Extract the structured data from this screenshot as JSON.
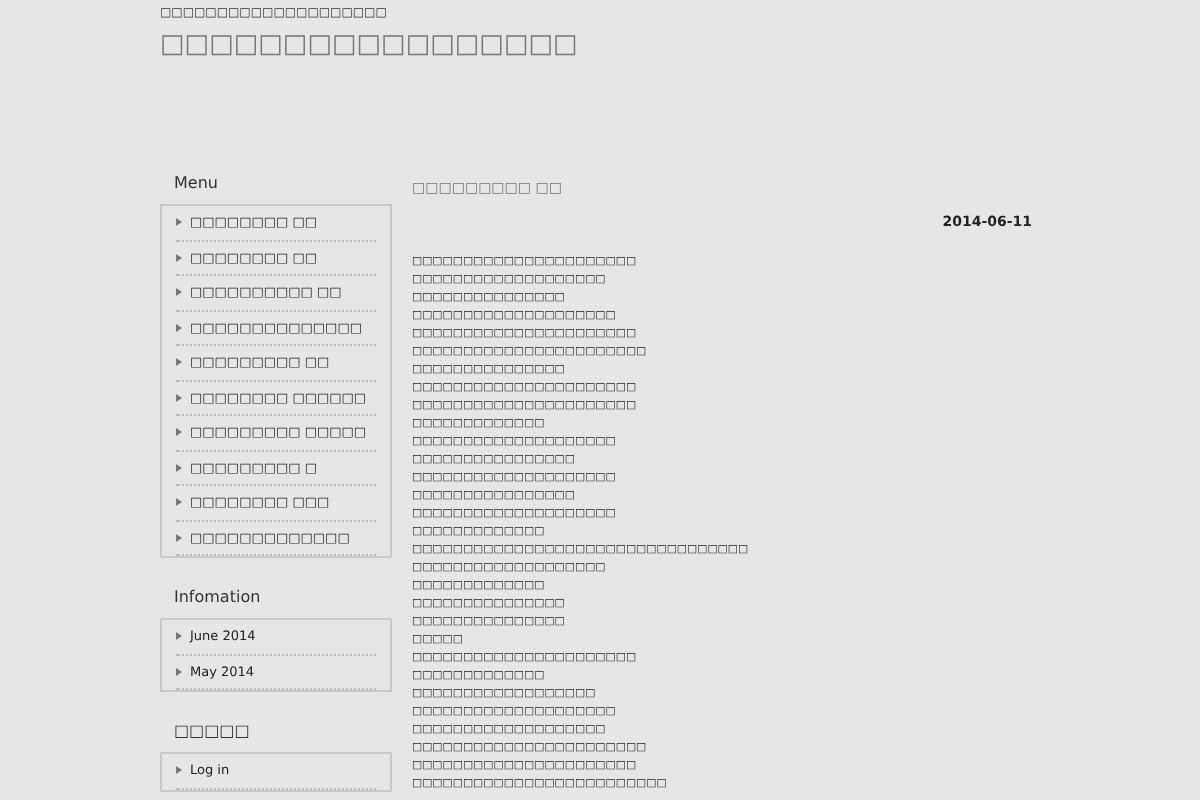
{
  "site": {
    "tagline": "□□□□□□□□□□□□□□□□□□□□",
    "title": "□□□□□□□□□□□□□□□□□"
  },
  "sidebar": {
    "widgets": [
      {
        "title": "Menu",
        "items": [
          "□□□□□□□□ □□",
          "□□□□□□□□ □□",
          "□□□□□□□□□□ □□",
          "□□□□□□□□□□□□□□",
          "□□□□□□□□□ □□",
          "□□□□□□□□ □□□□□□",
          "□□□□□□□□□ □□□□□",
          "□□□□□□□□□ □",
          "□□□□□□□□ □□□",
          "□□□□□□□□□□□□□"
        ]
      },
      {
        "title": "Infomation",
        "items": [
          "June 2014",
          "May 2014"
        ]
      },
      {
        "title": "□□□□□",
        "items": [
          "Log in"
        ]
      }
    ]
  },
  "post": {
    "title": "□□□□□□□□□ □□",
    "date": "2014-06-11",
    "lines": [
      "□□□□□□□□□□□□□□□□□□□□□□",
      "□□□□□□□□□□□□□□□□□□□",
      "□□□□□□□□□□□□□□□",
      "□□□□□□□□□□□□□□□□□□□□",
      "□□□□□□□□□□□□□□□□□□□□□□",
      "□□□□□□□□□□□□□□□□□□□□□□□",
      "□□□□□□□□□□□□□□□",
      "□□□□□□□□□□□□□□□□□□□□□□",
      "□□□□□□□□□□□□□□□□□□□□□□",
      "□□□□□□□□□□□□□",
      "□□□□□□□□□□□□□□□□□□□□",
      "□□□□□□□□□□□□□□□□",
      "□□□□□□□□□□□□□□□□□□□□",
      "□□□□□□□□□□□□□□□□",
      "□□□□□□□□□□□□□□□□□□□□",
      "□□□□□□□□□□□□□",
      "□□□□□□□□□□□□□□□□□□□□□□□□□□□□□□□□□",
      "□□□□□□□□□□□□□□□□□□□",
      "□□□□□□□□□□□□□",
      "□□□□□□□□□□□□□□□",
      "□□□□□□□□□□□□□□□",
      "□□□□□",
      "□□□□□□□□□□□□□□□□□□□□□□",
      "□□□□□□□□□□□□□",
      "□□□□□□□□□□□□□□□□□□",
      "□□□□□□□□□□□□□□□□□□□□",
      "□□□□□□□□□□□□□□□□□□□",
      "□□□□□□□□□□□□□□□□□□□□□□□",
      "□□□□□□□□□□□□□□□□□□□□□□",
      "□□□□□□□□□□□□□□□□□□□□□□□□□"
    ]
  }
}
